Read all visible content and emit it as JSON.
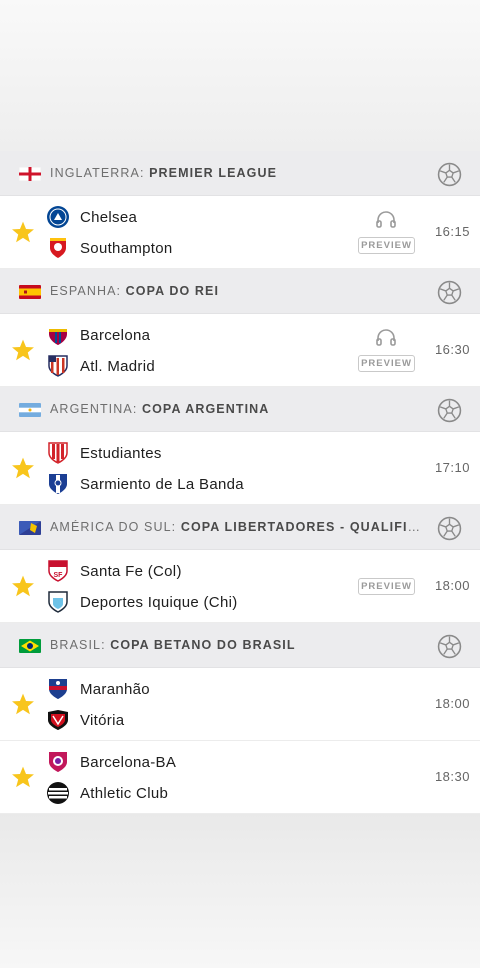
{
  "leagues": [
    {
      "country": "INGLATERRA:",
      "name": "PREMIER LEAGUE",
      "flag": "england-flag",
      "matches": [
        {
          "home": "Chelsea",
          "away": "Southampton",
          "time": "16:15",
          "preview": "PREVIEW",
          "audio": true
        }
      ]
    },
    {
      "country": "ESPANHA:",
      "name": "COPA DO REI",
      "flag": "spain-flag",
      "matches": [
        {
          "home": "Barcelona",
          "away": "Atl. Madrid",
          "time": "16:30",
          "preview": "PREVIEW",
          "audio": true
        }
      ]
    },
    {
      "country": "ARGENTINA:",
      "name": "COPA ARGENTINA",
      "flag": "argentina-flag",
      "matches": [
        {
          "home": "Estudiantes",
          "away": "Sarmiento de La Banda",
          "time": "17:10"
        }
      ]
    },
    {
      "country": "AMÉRICA DO SUL:",
      "name": "COPA LIBERTADORES - QUALIFICA...",
      "flag": "south-america-flag",
      "matches": [
        {
          "home": "Santa Fe (Col)",
          "away": "Deportes Iquique (Chi)",
          "time": "18:00",
          "preview": "PREVIEW"
        }
      ]
    },
    {
      "country": "BRASIL:",
      "name": "COPA BETANO DO BRASIL",
      "flag": "brazil-flag",
      "matches": [
        {
          "home": "Maranhão",
          "away": "Vitória",
          "time": "18:00"
        },
        {
          "home": "Barcelona-BA",
          "away": "Athletic Club",
          "time": "18:30"
        }
      ]
    }
  ],
  "colors": {
    "favorite_star": "#f8c51c",
    "header_bg": "#ececee"
  },
  "icons": {
    "favorite": "star-icon",
    "sport": "soccer-ball-icon",
    "audio": "headphones-icon"
  }
}
